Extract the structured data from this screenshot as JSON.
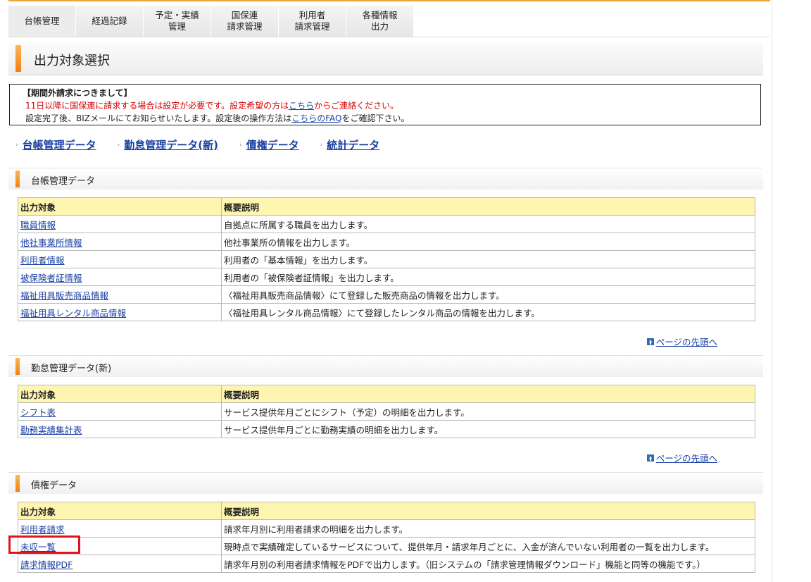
{
  "nav": {
    "tabs": [
      "台帳管理",
      "経過記録",
      "予定・実績\n管理",
      "国保連\n請求管理",
      "利用者\n請求管理",
      "各種情報\n出力"
    ]
  },
  "page_title": "出力対象選択",
  "notice": {
    "heading": "【期間外請求につきまして】",
    "line1_prefix": "11日以降に国保連に請求する場合は設定が必要です。設定希望の方は",
    "line1_link": "こちら",
    "line1_suffix": "からご連絡ください。",
    "line2_prefix": "設定完了後、BIZメールにてお知らせいたします。設定後の操作方法は",
    "line2_link": "こちらのFAQ",
    "line2_suffix": "をご確認下さい。"
  },
  "quicklinks": [
    "台帳管理データ",
    "勤怠管理データ(新)",
    "債権データ",
    "統計データ"
  ],
  "table_headers": {
    "col1": "出力対象",
    "col2": "概要説明"
  },
  "to_top_label": "ページの先頭へ",
  "sections": [
    {
      "title": "台帳管理データ",
      "rows": [
        {
          "target": "職員情報",
          "desc": "自拠点に所属する職員を出力します。"
        },
        {
          "target": "他社事業所情報",
          "desc": "他社事業所の情報を出力します。"
        },
        {
          "target": "利用者情報",
          "desc": "利用者の「基本情報」を出力します。"
        },
        {
          "target": "被保険者証情報",
          "desc": "利用者の「被保険者証情報」を出力します。"
        },
        {
          "target": "福祉用具販売商品情報",
          "desc": "〈福祉用具販売商品情報〉にて登録した販売商品の情報を出力します。"
        },
        {
          "target": "福祉用具レンタル商品情報",
          "desc": "〈福祉用具レンタル商品情報〉にて登録したレンタル商品の情報を出力します。"
        }
      ]
    },
    {
      "title": "勤怠管理データ(新)",
      "rows": [
        {
          "target": "シフト表",
          "desc": "サービス提供年月ごとにシフト（予定）の明細を出力します。"
        },
        {
          "target": "勤務実績集計表",
          "desc": "サービス提供年月ごとに勤務実績の明細を出力します。"
        }
      ]
    },
    {
      "title": "債権データ",
      "rows": [
        {
          "target": "利用者請求",
          "desc": "請求年月別に利用者請求の明細を出力します。"
        },
        {
          "target": "未収一覧",
          "desc": "現時点で実績確定しているサービスについて、提供年月・請求年月ごとに、入金が済んでいない利用者の一覧を出力します。"
        },
        {
          "target": "請求情報PDF",
          "desc": "請求年月別の利用者請求情報をPDFで出力します。（旧システムの「請求管理情報ダウンロード」機能と同等の機能です。）"
        }
      ]
    }
  ]
}
